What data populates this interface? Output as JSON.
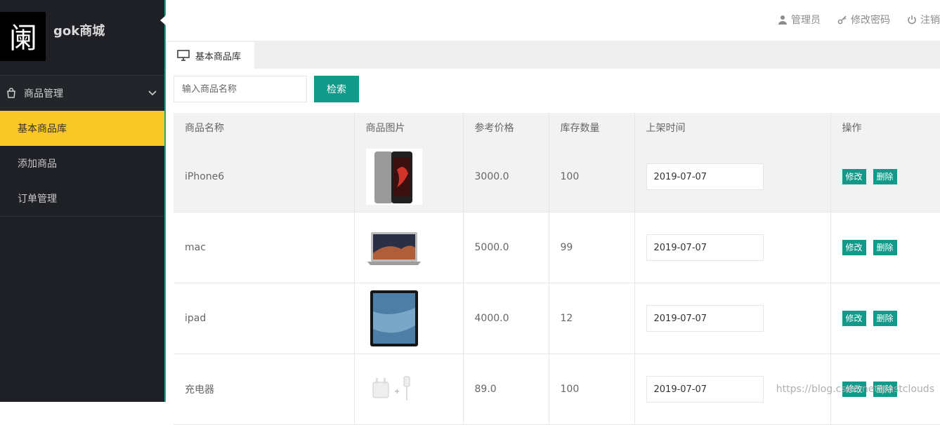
{
  "brand": {
    "name": "gok商城",
    "logo_glyph": "阑"
  },
  "sidebar": {
    "group_label": "商品管理",
    "items": [
      {
        "label": "基本商品库",
        "active": true
      },
      {
        "label": "添加商品",
        "active": false
      },
      {
        "label": "订单管理",
        "active": false
      }
    ]
  },
  "topbar": {
    "user": "管理员",
    "change_password": "修改密码",
    "logout": "注销"
  },
  "tab": {
    "label": "基本商品库"
  },
  "search": {
    "placeholder": "输入商品名称",
    "value": "",
    "button": "检索"
  },
  "table": {
    "headers": [
      "商品名称",
      "商品图片",
      "参考价格",
      "库存数量",
      "上架时间",
      "操作"
    ],
    "rows": [
      {
        "name": "iPhone6",
        "image": "iphone-image",
        "price": "3000.0",
        "stock": "100",
        "date": "2019-07-07",
        "edit": "修改",
        "delete": "删除"
      },
      {
        "name": "mac",
        "image": "macbook-image",
        "price": "5000.0",
        "stock": "99",
        "date": "2019-07-07",
        "edit": "修改",
        "delete": "删除"
      },
      {
        "name": "ipad",
        "image": "ipad-image",
        "price": "4000.0",
        "stock": "12",
        "date": "2019-07-07",
        "edit": "修改",
        "delete": "删除"
      },
      {
        "name": "充电器",
        "image": "charger-image",
        "price": "89.0",
        "stock": "100",
        "date": "2019-07-07",
        "edit": "修改",
        "delete": "删除"
      }
    ]
  },
  "watermark": "https://blog.csdn.net/pastclouds",
  "colors": {
    "accent": "#11998a",
    "active_menu": "#f9c825",
    "sidebar_bg": "#1e2025"
  }
}
